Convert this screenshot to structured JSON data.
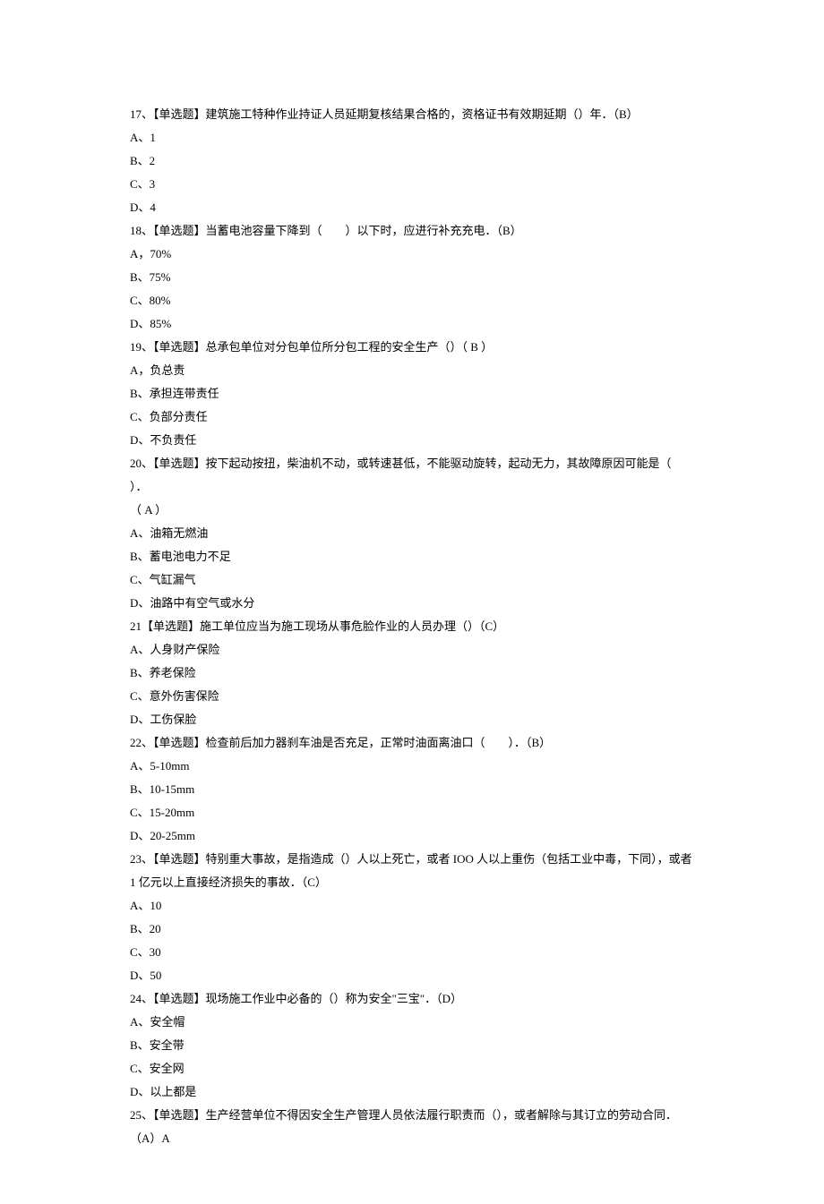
{
  "lines": [
    "17、【单选题】建筑施工特种作业持证人员延期复核结果合格的，资格证书有效期延期（）年．（B）",
    "A、1",
    "B、2",
    "C、3",
    "D、4",
    "18、【单选题】当蓄电池容量下降到（　　）以下时，应进行补充充电．（B）",
    "A，70%",
    "B、75%",
    "C、80%",
    "D、85%",
    "19、【单选题】总承包单位对分包单位所分包工程的安全生产（）（ B ）",
    "A，负总责",
    "B、承担连带责任",
    "C、负部分责任",
    "D、不负责任",
    "20、【单选题】按下起动按扭，柴油机不动，或转速甚低，不能驱动旋转，起动无力，其故障原因可能是（　　）．",
    "（ A ）",
    "A、油箱无燃油",
    "B、蓄电池电力不足",
    "C、气缸漏气",
    "D、油路中有空气或水分",
    "21【单选题】施工单位应当为施工现场从事危脸作业的人员办理（）（C）",
    "A、人身财产保险",
    "B、养老保险",
    "C、意外伤害保险",
    "D、工伤保脸",
    "22、【单选题】检查前后加力器刹车油是否充足，正常时油面离油口（　　）．（B）",
    "A、5-10mm",
    "B、10-15mm",
    "C、15-20mm",
    "D、20-25mm",
    "23、【单选题】特别重大事故，是指造成（）人以上死亡，或者 IOO 人以上重伤（包括工业中毒，下同），或者 1 亿元以上直接经济损失的事故．（C）",
    "A、10",
    "B、20",
    "C、30",
    "D、50",
    "24、【单选题】现场施工作业中必备的（）称为安全\"三宝\"．（D）",
    "A、安全帽",
    "B、安全带",
    "C、安全网",
    "D、以上都是",
    "25、【单选题】生产经营单位不得因安全生产管理人员依法履行职责而（），或者解除与其订立的劳动合同．（A）A"
  ]
}
